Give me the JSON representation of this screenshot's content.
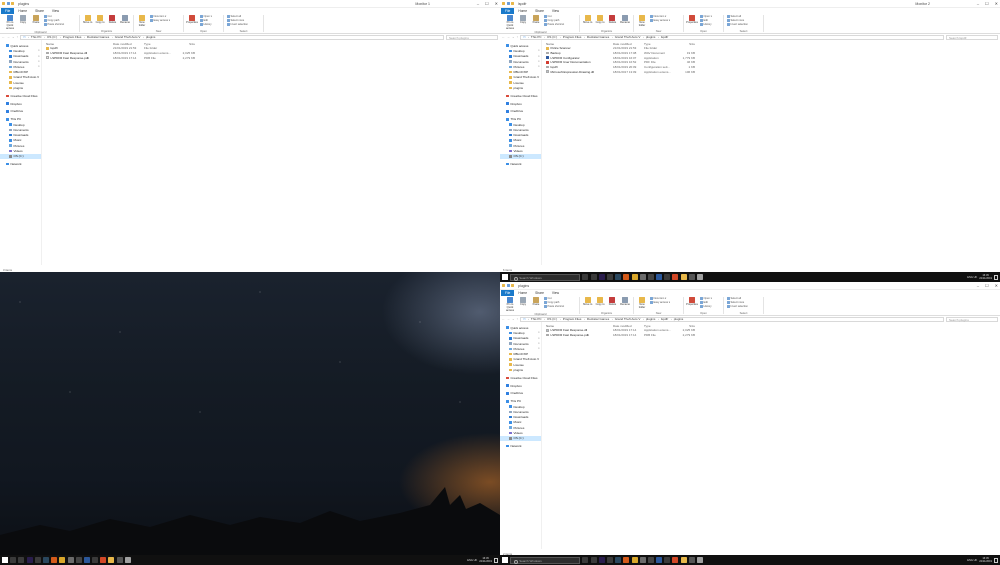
{
  "colors": {
    "accent": "#1979ca",
    "folder": "#e8b84a",
    "taskbar": "#101010"
  },
  "ribbon": {
    "tabs": [
      "File",
      "Home",
      "Share",
      "View"
    ],
    "clipboard": {
      "label": "Clipboard",
      "pin": "Pin to Quick access",
      "copy": "Copy",
      "paste": "Paste",
      "cut": "Cut",
      "copy_path": "Copy path",
      "paste_shortcut": "Paste shortcut"
    },
    "organize": {
      "label": "Organize",
      "move": "Move to",
      "copy": "Copy to",
      "delete": "Delete",
      "rename": "Rename"
    },
    "new": {
      "label": "New",
      "folder": "New folder",
      "new_item": "New item ▾",
      "easy_access": "Easy access ▾"
    },
    "open": {
      "label": "Open",
      "properties": "Properties",
      "open": "Open ▾",
      "edit": "Edit",
      "history": "History"
    },
    "select": {
      "label": "Select",
      "select_all": "Select all",
      "select_none": "Select none",
      "invert": "Invert selection"
    }
  },
  "columns": {
    "name": "Name",
    "date": "Date modified",
    "type": "Type",
    "size": "Size"
  },
  "search_prefix": "Search ",
  "nav": [
    {
      "label": "Quick access",
      "level": 0,
      "icon": "star-icon",
      "color": "#3a8ee6"
    },
    {
      "label": "Desktop",
      "level": 1,
      "icon": "desktop-icon",
      "color": "#3a8ee6",
      "pin": true
    },
    {
      "label": "Downloads",
      "level": 1,
      "icon": "downloads-icon",
      "color": "#2b7bd6",
      "pin": true
    },
    {
      "label": "Documents",
      "level": 1,
      "icon": "documents-icon",
      "color": "#8fa6c0",
      "pin": true
    },
    {
      "label": "Pictures",
      "level": 1,
      "icon": "pictures-icon",
      "color": "#6aa7e0",
      "pin": true
    },
    {
      "label": "RBLCFXIP",
      "level": 1,
      "icon": "folder-icon",
      "color": "#e8b84a"
    },
    {
      "label": "Grand Theft Auto V",
      "level": 1,
      "icon": "folder-icon",
      "color": "#e8b84a"
    },
    {
      "label": "License",
      "level": 1,
      "icon": "folder-icon",
      "color": "#e8b84a"
    },
    {
      "label": "plugins",
      "level": 1,
      "icon": "folder-icon",
      "color": "#e8b84a"
    },
    {
      "gap": true
    },
    {
      "label": "Creative Cloud Files",
      "level": 0,
      "icon": "cloud-icon",
      "color": "#d94a3a"
    },
    {
      "gap": true
    },
    {
      "label": "Dropbox",
      "level": 0,
      "icon": "dropbox-icon",
      "color": "#2f7fe0"
    },
    {
      "gap": true
    },
    {
      "label": "OneDrive",
      "level": 0,
      "icon": "onedrive-icon",
      "color": "#2f7fe0"
    },
    {
      "gap": true
    },
    {
      "label": "This PC",
      "level": 0,
      "icon": "pc-icon",
      "color": "#3a8ee6"
    },
    {
      "label": "Desktop",
      "level": 1,
      "icon": "desktop-icon",
      "color": "#3a8ee6"
    },
    {
      "label": "Documents",
      "level": 1,
      "icon": "documents-icon",
      "color": "#8fa6c0"
    },
    {
      "label": "Downloads",
      "level": 1,
      "icon": "downloads-icon",
      "color": "#2b7bd6"
    },
    {
      "label": "Music",
      "level": 1,
      "icon": "music-icon",
      "color": "#3a8ee6"
    },
    {
      "label": "Pictures",
      "level": 1,
      "icon": "pictures-icon",
      "color": "#6aa7e0"
    },
    {
      "label": "Videos",
      "level": 1,
      "icon": "videos-icon",
      "color": "#7a6fd0"
    },
    {
      "label": "OS (C:)",
      "level": 1,
      "icon": "drive-icon",
      "color": "#8a8a8a",
      "selected": true
    },
    {
      "gap": true
    },
    {
      "label": "Network",
      "level": 0,
      "icon": "network-icon",
      "color": "#3a8ee6"
    }
  ],
  "windows": {
    "tl": {
      "title": "plugins",
      "monitor": "Monitor 1",
      "path": [
        "This PC",
        "OS (C:)",
        "Program Files",
        "Rockstar Games",
        "Grand Theft Auto V",
        "plugins"
      ],
      "files": [
        {
          "name": "lspdfr",
          "date": "21/01/2019 21:53",
          "type": "File folder",
          "size": "",
          "kind": "folder"
        },
        {
          "name": "LSPDFR Fast Response.dll",
          "date": "18/01/2019 17:14",
          "type": "Application extens...",
          "size": "2,025 KB",
          "kind": "dll"
        },
        {
          "name": "LSPDFR Fast Response.pdb",
          "date": "18/01/2019 17:14",
          "type": "PDB File",
          "size": "2,279 KB",
          "kind": "file"
        }
      ],
      "status": "3 items"
    },
    "tr": {
      "title": "lspdfr",
      "monitor": "Monitor 2",
      "path": [
        "This PC",
        "OS (C:)",
        "Program Files",
        "Rockstar Games",
        "Grand Theft Auto V",
        "plugins",
        "lspdfr"
      ],
      "files": [
        {
          "name": "Police Scanner",
          "date": "21/01/2019 21:53",
          "type": "File folder",
          "size": "",
          "kind": "folder"
        },
        {
          "name": "Backup",
          "date": "18/01/2019 17:08",
          "type": "WAV Document",
          "size": "19 KB",
          "kind": "file"
        },
        {
          "name": "LSPDFR Configurator",
          "date": "18/01/2019 16:07",
          "type": "Application",
          "size": "1,779 KB",
          "kind": "exe"
        },
        {
          "name": "LSPDFR User Documentation",
          "date": "18/01/2019 16:52",
          "type": "PDF File",
          "size": "46 KB",
          "kind": "pdf"
        },
        {
          "name": "lspdfr",
          "date": "18/01/2019 20:09",
          "type": "Configuration sett...",
          "size": "1 KB",
          "kind": "file"
        },
        {
          "name": "Microsoft.Expression.Drawing.dll",
          "date": "18/01/2017 13:09",
          "type": "Application extens...",
          "size": "106 KB",
          "kind": "dll"
        }
      ],
      "status": "6 items"
    },
    "br": {
      "title": "plugins",
      "monitor": "",
      "path": [
        "This PC",
        "OS (C:)",
        "Program Files",
        "Rockstar Games",
        "Grand Theft Auto V",
        "plugins",
        "lspdfr",
        "plugins"
      ],
      "files": [
        {
          "name": "LSPDFR Fast Response.dll",
          "date": "18/01/2019 17:14",
          "type": "Application extens...",
          "size": "2,025 KB",
          "kind": "dll"
        },
        {
          "name": "LSPDFR Fast Response.pdb",
          "date": "18/01/2019 17:14",
          "type": "PDB File",
          "size": "2,279 KB",
          "kind": "file"
        }
      ],
      "status": "2 items"
    }
  },
  "taskbar": {
    "search_placeholder": "Search Windows",
    "time": "16:45",
    "date": "22/11/2019",
    "lang": "ENG UK",
    "apps": [
      {
        "name": "cortana-icon",
        "color": "#3a3a3a"
      },
      {
        "name": "task-view-icon",
        "color": "#3a3a3a"
      },
      {
        "name": "premiere-icon",
        "color": "#2a1d4d"
      },
      {
        "name": "obs-icon",
        "color": "#3a3a3a"
      },
      {
        "name": "steam-icon",
        "color": "#2a475e"
      },
      {
        "name": "game-icon",
        "color": "#d45a1a"
      },
      {
        "name": "chrome-icon",
        "color": "#d9a72a"
      },
      {
        "name": "app-icon",
        "color": "#6b6b6b"
      },
      {
        "name": "epic-icon",
        "color": "#444"
      },
      {
        "name": "word-icon",
        "color": "#2b579a"
      },
      {
        "name": "store-icon",
        "color": "#3a3a3a"
      },
      {
        "name": "powerpoint-icon",
        "color": "#d24726"
      },
      {
        "name": "explorer-icon",
        "color": "#e8b84a"
      },
      {
        "name": "settings-icon",
        "color": "#555"
      },
      {
        "name": "media-icon",
        "color": "#a0a0a0"
      }
    ]
  }
}
